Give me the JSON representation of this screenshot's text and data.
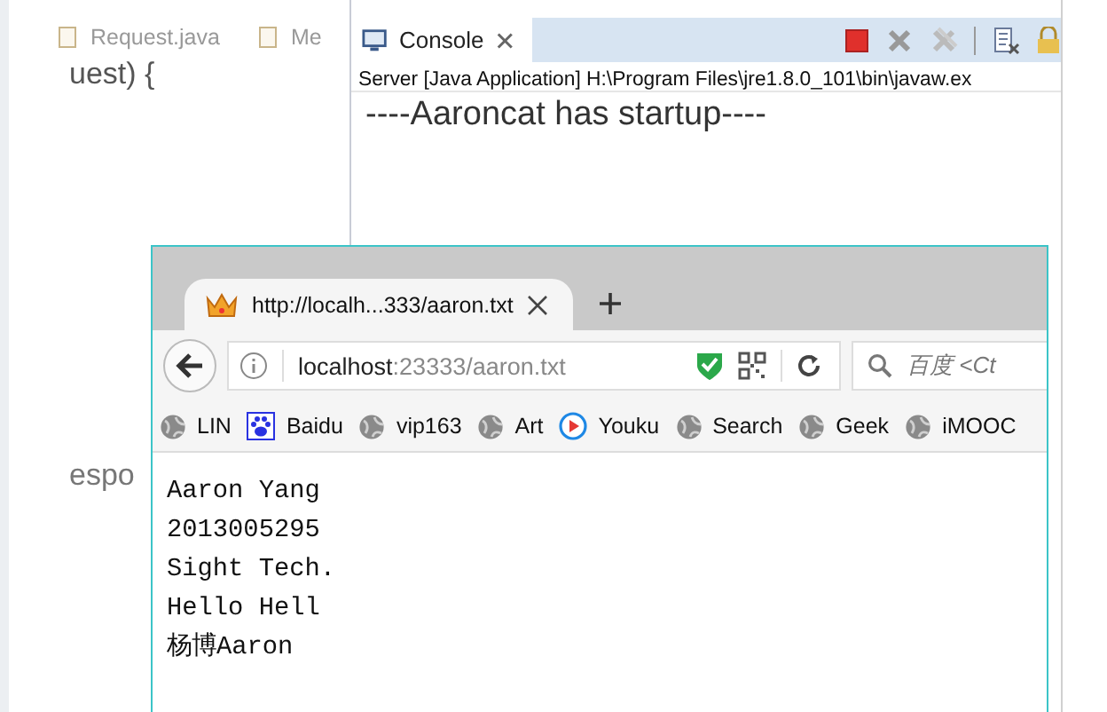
{
  "editor": {
    "tabs": [
      {
        "label": "Request.java",
        "selected": false
      },
      {
        "label": "Me",
        "selected": false
      }
    ],
    "code_lines": [
      "uest) {",
      "espo"
    ]
  },
  "console": {
    "tab": {
      "label": "Console",
      "selected": true
    },
    "process": "Server [Java Application] H:\\Program Files\\jre1.8.0_101\\bin\\javaw.ex",
    "output": "----Aaroncat has startup----"
  },
  "browser": {
    "tab": {
      "title": "http://localh...333/aaron.txt",
      "selected": true
    },
    "url": {
      "host": "localhost",
      "rest": ":23333/aaron.txt"
    },
    "search": {
      "placeholder": "百度 <Ct"
    },
    "bookmarks": [
      {
        "label": "LIN",
        "kind": "globe"
      },
      {
        "label": "Baidu",
        "kind": "paw"
      },
      {
        "label": "vip163",
        "kind": "globe"
      },
      {
        "label": "Art",
        "kind": "globe"
      },
      {
        "label": "Youku",
        "kind": "play"
      },
      {
        "label": "Search",
        "kind": "globe"
      },
      {
        "label": "Geek",
        "kind": "globe"
      },
      {
        "label": "iMOOC",
        "kind": "globe"
      }
    ],
    "content_lines": [
      "Aaron Yang",
      "2013005295",
      "Sight Tech.",
      "Hello Hell",
      "杨博Aaron"
    ]
  }
}
